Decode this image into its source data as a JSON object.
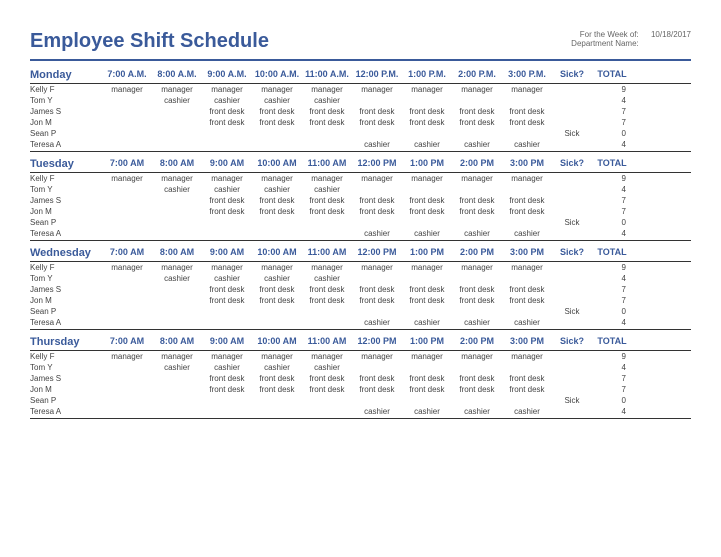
{
  "title": "Employee Shift Schedule",
  "meta": {
    "week_label": "For the Week of:",
    "week_value": "10/18/2017",
    "dept_label": "Department Name:",
    "dept_value": ""
  },
  "columns": {
    "sick": "Sick?",
    "total": "TOTAL"
  },
  "days": [
    {
      "name": "Monday",
      "times": [
        "7:00 A.M.",
        "8:00 A.M.",
        "9:00 A.M.",
        "10:00 A.M.",
        "11:00 A.M.",
        "12:00 P.M.",
        "1:00 P.M.",
        "2:00 P.M.",
        "3:00 P.M."
      ],
      "rows": [
        {
          "name": "Kelly F",
          "shifts": [
            "manager",
            "manager",
            "manager",
            "manager",
            "manager",
            "manager",
            "manager",
            "manager",
            "manager"
          ],
          "sick": "",
          "total": "9"
        },
        {
          "name": "Tom Y",
          "shifts": [
            "",
            "cashier",
            "cashier",
            "cashier",
            "cashier",
            "",
            "",
            "",
            ""
          ],
          "sick": "",
          "total": "4"
        },
        {
          "name": "James S",
          "shifts": [
            "",
            "",
            "front desk",
            "front desk",
            "front desk",
            "front desk",
            "front desk",
            "front desk",
            "front desk"
          ],
          "sick": "",
          "total": "7"
        },
        {
          "name": "Jon M",
          "shifts": [
            "",
            "",
            "front desk",
            "front desk",
            "front desk",
            "front desk",
            "front desk",
            "front desk",
            "front desk"
          ],
          "sick": "",
          "total": "7"
        },
        {
          "name": "Sean P",
          "shifts": [
            "",
            "",
            "",
            "",
            "",
            "",
            "",
            "",
            ""
          ],
          "sick": "Sick",
          "total": "0"
        },
        {
          "name": "Teresa A",
          "shifts": [
            "",
            "",
            "",
            "",
            "",
            "cashier",
            "cashier",
            "cashier",
            "cashier"
          ],
          "sick": "",
          "total": "4"
        }
      ]
    },
    {
      "name": "Tuesday",
      "times": [
        "7:00 AM",
        "8:00 AM",
        "9:00 AM",
        "10:00 AM",
        "11:00 AM",
        "12:00 PM",
        "1:00 PM",
        "2:00 PM",
        "3:00 PM"
      ],
      "rows": [
        {
          "name": "Kelly F",
          "shifts": [
            "manager",
            "manager",
            "manager",
            "manager",
            "manager",
            "manager",
            "manager",
            "manager",
            "manager"
          ],
          "sick": "",
          "total": "9"
        },
        {
          "name": "Tom Y",
          "shifts": [
            "",
            "cashier",
            "cashier",
            "cashier",
            "cashier",
            "",
            "",
            "",
            ""
          ],
          "sick": "",
          "total": "4"
        },
        {
          "name": "James S",
          "shifts": [
            "",
            "",
            "front desk",
            "front desk",
            "front desk",
            "front desk",
            "front desk",
            "front desk",
            "front desk"
          ],
          "sick": "",
          "total": "7"
        },
        {
          "name": "Jon M",
          "shifts": [
            "",
            "",
            "front desk",
            "front desk",
            "front desk",
            "front desk",
            "front desk",
            "front desk",
            "front desk"
          ],
          "sick": "",
          "total": "7"
        },
        {
          "name": "Sean P",
          "shifts": [
            "",
            "",
            "",
            "",
            "",
            "",
            "",
            "",
            ""
          ],
          "sick": "Sick",
          "total": "0"
        },
        {
          "name": "Teresa A",
          "shifts": [
            "",
            "",
            "",
            "",
            "",
            "cashier",
            "cashier",
            "cashier",
            "cashier"
          ],
          "sick": "",
          "total": "4"
        }
      ]
    },
    {
      "name": "Wednesday",
      "times": [
        "7:00 AM",
        "8:00 AM",
        "9:00 AM",
        "10:00 AM",
        "11:00 AM",
        "12:00 PM",
        "1:00 PM",
        "2:00 PM",
        "3:00 PM"
      ],
      "rows": [
        {
          "name": "Kelly F",
          "shifts": [
            "manager",
            "manager",
            "manager",
            "manager",
            "manager",
            "manager",
            "manager",
            "manager",
            "manager"
          ],
          "sick": "",
          "total": "9"
        },
        {
          "name": "Tom Y",
          "shifts": [
            "",
            "cashier",
            "cashier",
            "cashier",
            "cashier",
            "",
            "",
            "",
            ""
          ],
          "sick": "",
          "total": "4"
        },
        {
          "name": "James S",
          "shifts": [
            "",
            "",
            "front desk",
            "front desk",
            "front desk",
            "front desk",
            "front desk",
            "front desk",
            "front desk"
          ],
          "sick": "",
          "total": "7"
        },
        {
          "name": "Jon M",
          "shifts": [
            "",
            "",
            "front desk",
            "front desk",
            "front desk",
            "front desk",
            "front desk",
            "front desk",
            "front desk"
          ],
          "sick": "",
          "total": "7"
        },
        {
          "name": "Sean P",
          "shifts": [
            "",
            "",
            "",
            "",
            "",
            "",
            "",
            "",
            ""
          ],
          "sick": "Sick",
          "total": "0"
        },
        {
          "name": "Teresa A",
          "shifts": [
            "",
            "",
            "",
            "",
            "",
            "cashier",
            "cashier",
            "cashier",
            "cashier"
          ],
          "sick": "",
          "total": "4"
        }
      ]
    },
    {
      "name": "Thursday",
      "times": [
        "7:00 AM",
        "8:00 AM",
        "9:00 AM",
        "10:00 AM",
        "11:00 AM",
        "12:00 PM",
        "1:00 PM",
        "2:00 PM",
        "3:00 PM"
      ],
      "rows": [
        {
          "name": "Kelly F",
          "shifts": [
            "manager",
            "manager",
            "manager",
            "manager",
            "manager",
            "manager",
            "manager",
            "manager",
            "manager"
          ],
          "sick": "",
          "total": "9"
        },
        {
          "name": "Tom Y",
          "shifts": [
            "",
            "cashier",
            "cashier",
            "cashier",
            "cashier",
            "",
            "",
            "",
            ""
          ],
          "sick": "",
          "total": "4"
        },
        {
          "name": "James S",
          "shifts": [
            "",
            "",
            "front desk",
            "front desk",
            "front desk",
            "front desk",
            "front desk",
            "front desk",
            "front desk"
          ],
          "sick": "",
          "total": "7"
        },
        {
          "name": "Jon M",
          "shifts": [
            "",
            "",
            "front desk",
            "front desk",
            "front desk",
            "front desk",
            "front desk",
            "front desk",
            "front desk"
          ],
          "sick": "",
          "total": "7"
        },
        {
          "name": "Sean P",
          "shifts": [
            "",
            "",
            "",
            "",
            "",
            "",
            "",
            "",
            ""
          ],
          "sick": "Sick",
          "total": "0"
        },
        {
          "name": "Teresa A",
          "shifts": [
            "",
            "",
            "",
            "",
            "",
            "cashier",
            "cashier",
            "cashier",
            "cashier"
          ],
          "sick": "",
          "total": "4"
        }
      ]
    }
  ]
}
